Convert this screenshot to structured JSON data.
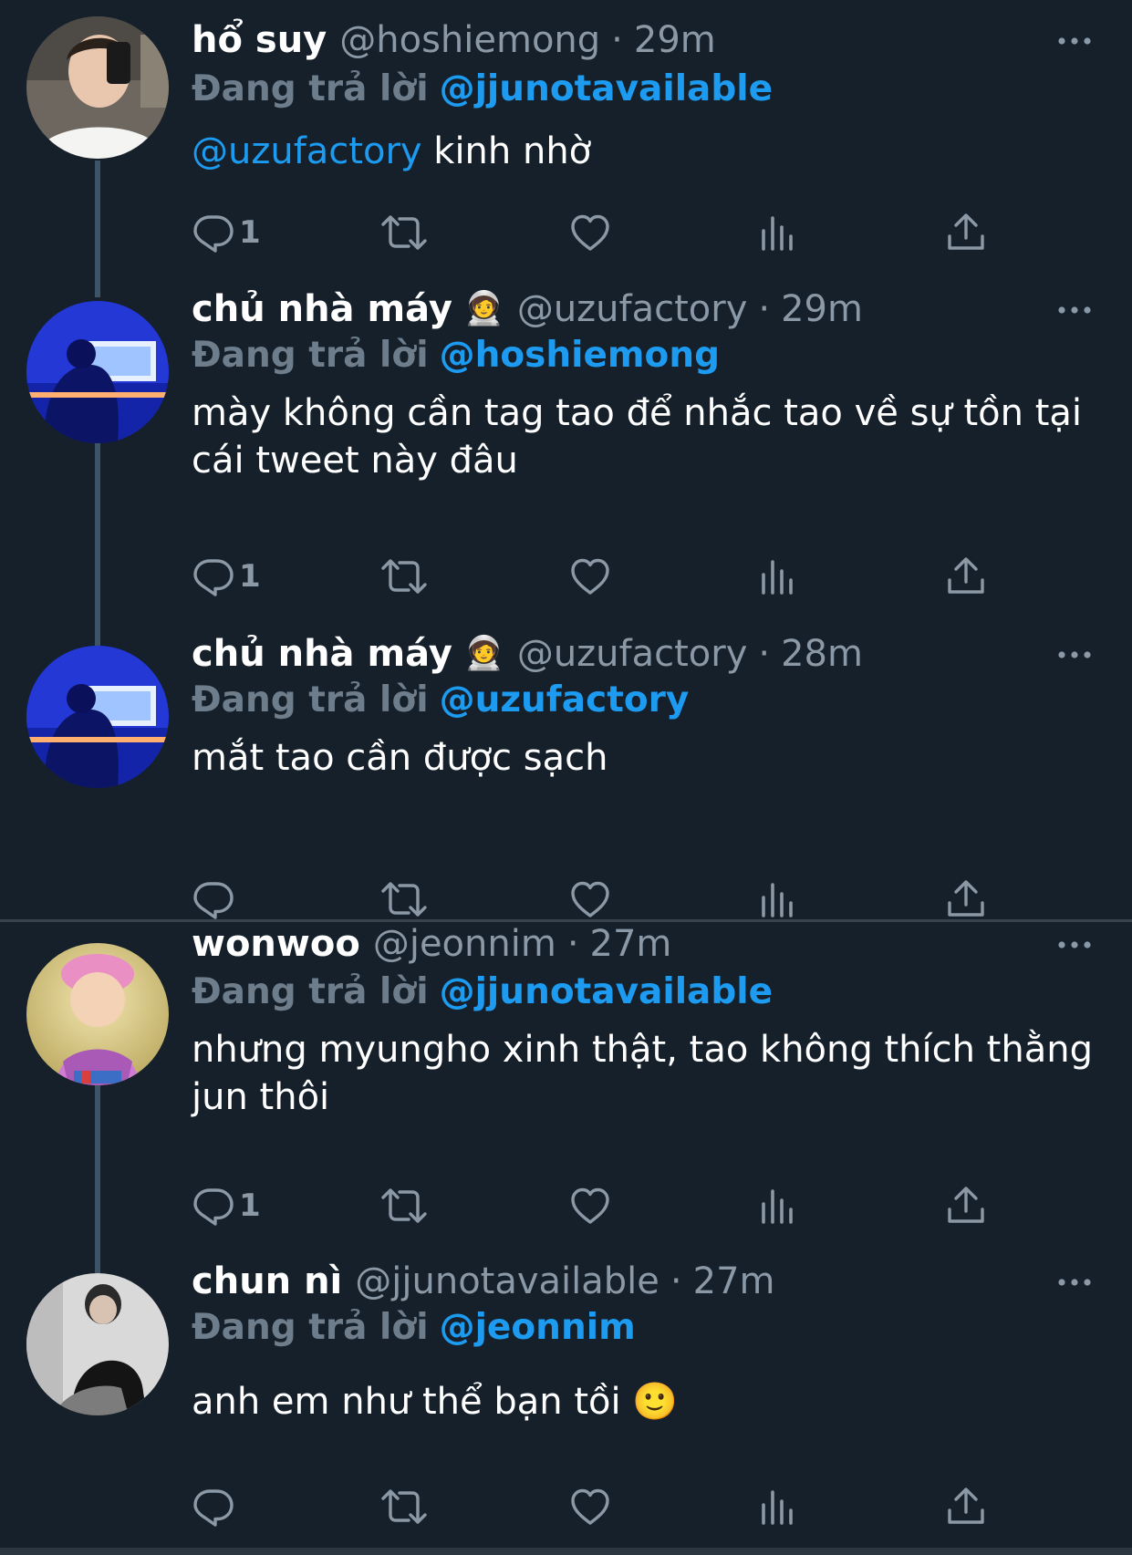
{
  "reply_label": "Đang trả lời",
  "colors": {
    "background": "#15202b",
    "mention": "#1d9bf0",
    "secondary_text": "#8b98a5",
    "thread_line": "#3d5466"
  },
  "tweets": [
    {
      "name": "hổ suy",
      "handle": "@hoshiemong",
      "time": "29m",
      "replying_to": "@jjunotavailable",
      "text_mention": "@uzufactory",
      "text": " kinh nhờ",
      "reply_count": "1"
    },
    {
      "name": "chủ nhà máy",
      "emoji": "🧑‍🚀",
      "handle": "@uzufactory",
      "time": "29m",
      "replying_to": "@hoshiemong",
      "text": "mày không cần tag tao để nhắc tao về sự tồn tại cái tweet này đâu",
      "reply_count": "1"
    },
    {
      "name": "chủ nhà máy",
      "emoji": "🧑‍🚀",
      "handle": "@uzufactory",
      "time": "28m",
      "replying_to": "@uzufactory",
      "text": "mắt tao cần được sạch",
      "reply_count": ""
    },
    {
      "name": "wonwoo",
      "handle": "@jeonnim",
      "time": "27m",
      "replying_to": "@jjunotavailable",
      "text": "nhưng myungho xinh thật, tao không thích thằng jun thôi",
      "reply_count": "1"
    },
    {
      "name": "chun nì",
      "handle": "@jjunotavailable",
      "time": "27m",
      "replying_to": "@jeonnim",
      "text": "anh em như thể bạn tồi",
      "text_emoji": "🙂",
      "reply_count": ""
    }
  ],
  "icons": {
    "reply": "reply-icon",
    "retweet": "retweet-icon",
    "like": "heart-icon",
    "views": "views-icon",
    "share": "share-icon",
    "more": "more-dots-icon"
  }
}
